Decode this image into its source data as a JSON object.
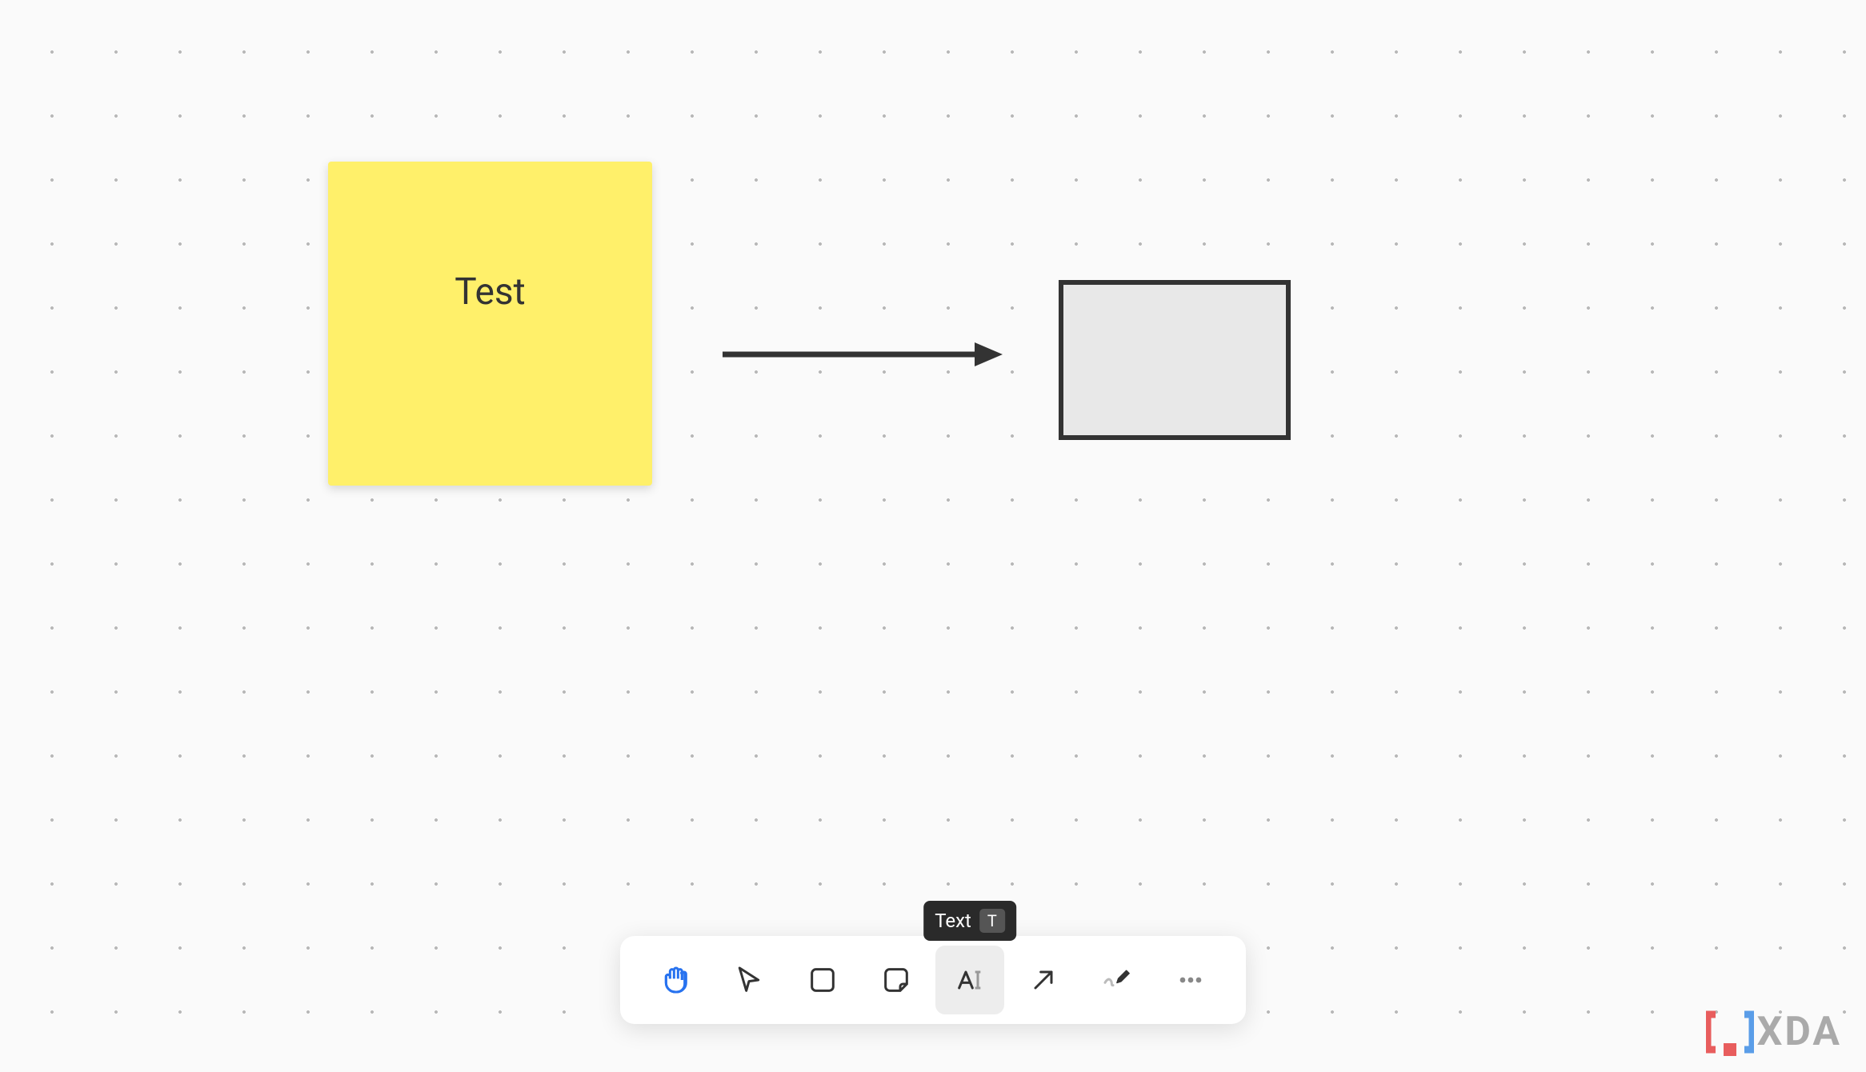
{
  "canvas": {
    "sticky_note": {
      "text": "Test",
      "bg_color": "#fff06a"
    },
    "arrow": {
      "stroke": "#333"
    },
    "rectangle": {
      "fill": "#e8e8e8",
      "stroke": "#333"
    }
  },
  "toolbar": {
    "tools": [
      {
        "name": "hand",
        "active": false
      },
      {
        "name": "select",
        "active": false
      },
      {
        "name": "rectangle",
        "active": false
      },
      {
        "name": "note",
        "active": false
      },
      {
        "name": "text",
        "active": true
      },
      {
        "name": "arrow",
        "active": false
      },
      {
        "name": "draw",
        "active": false
      },
      {
        "name": "more",
        "active": false
      }
    ],
    "tooltip": {
      "label": "Text",
      "shortcut": "T"
    }
  },
  "watermark": {
    "text": "XDA"
  }
}
